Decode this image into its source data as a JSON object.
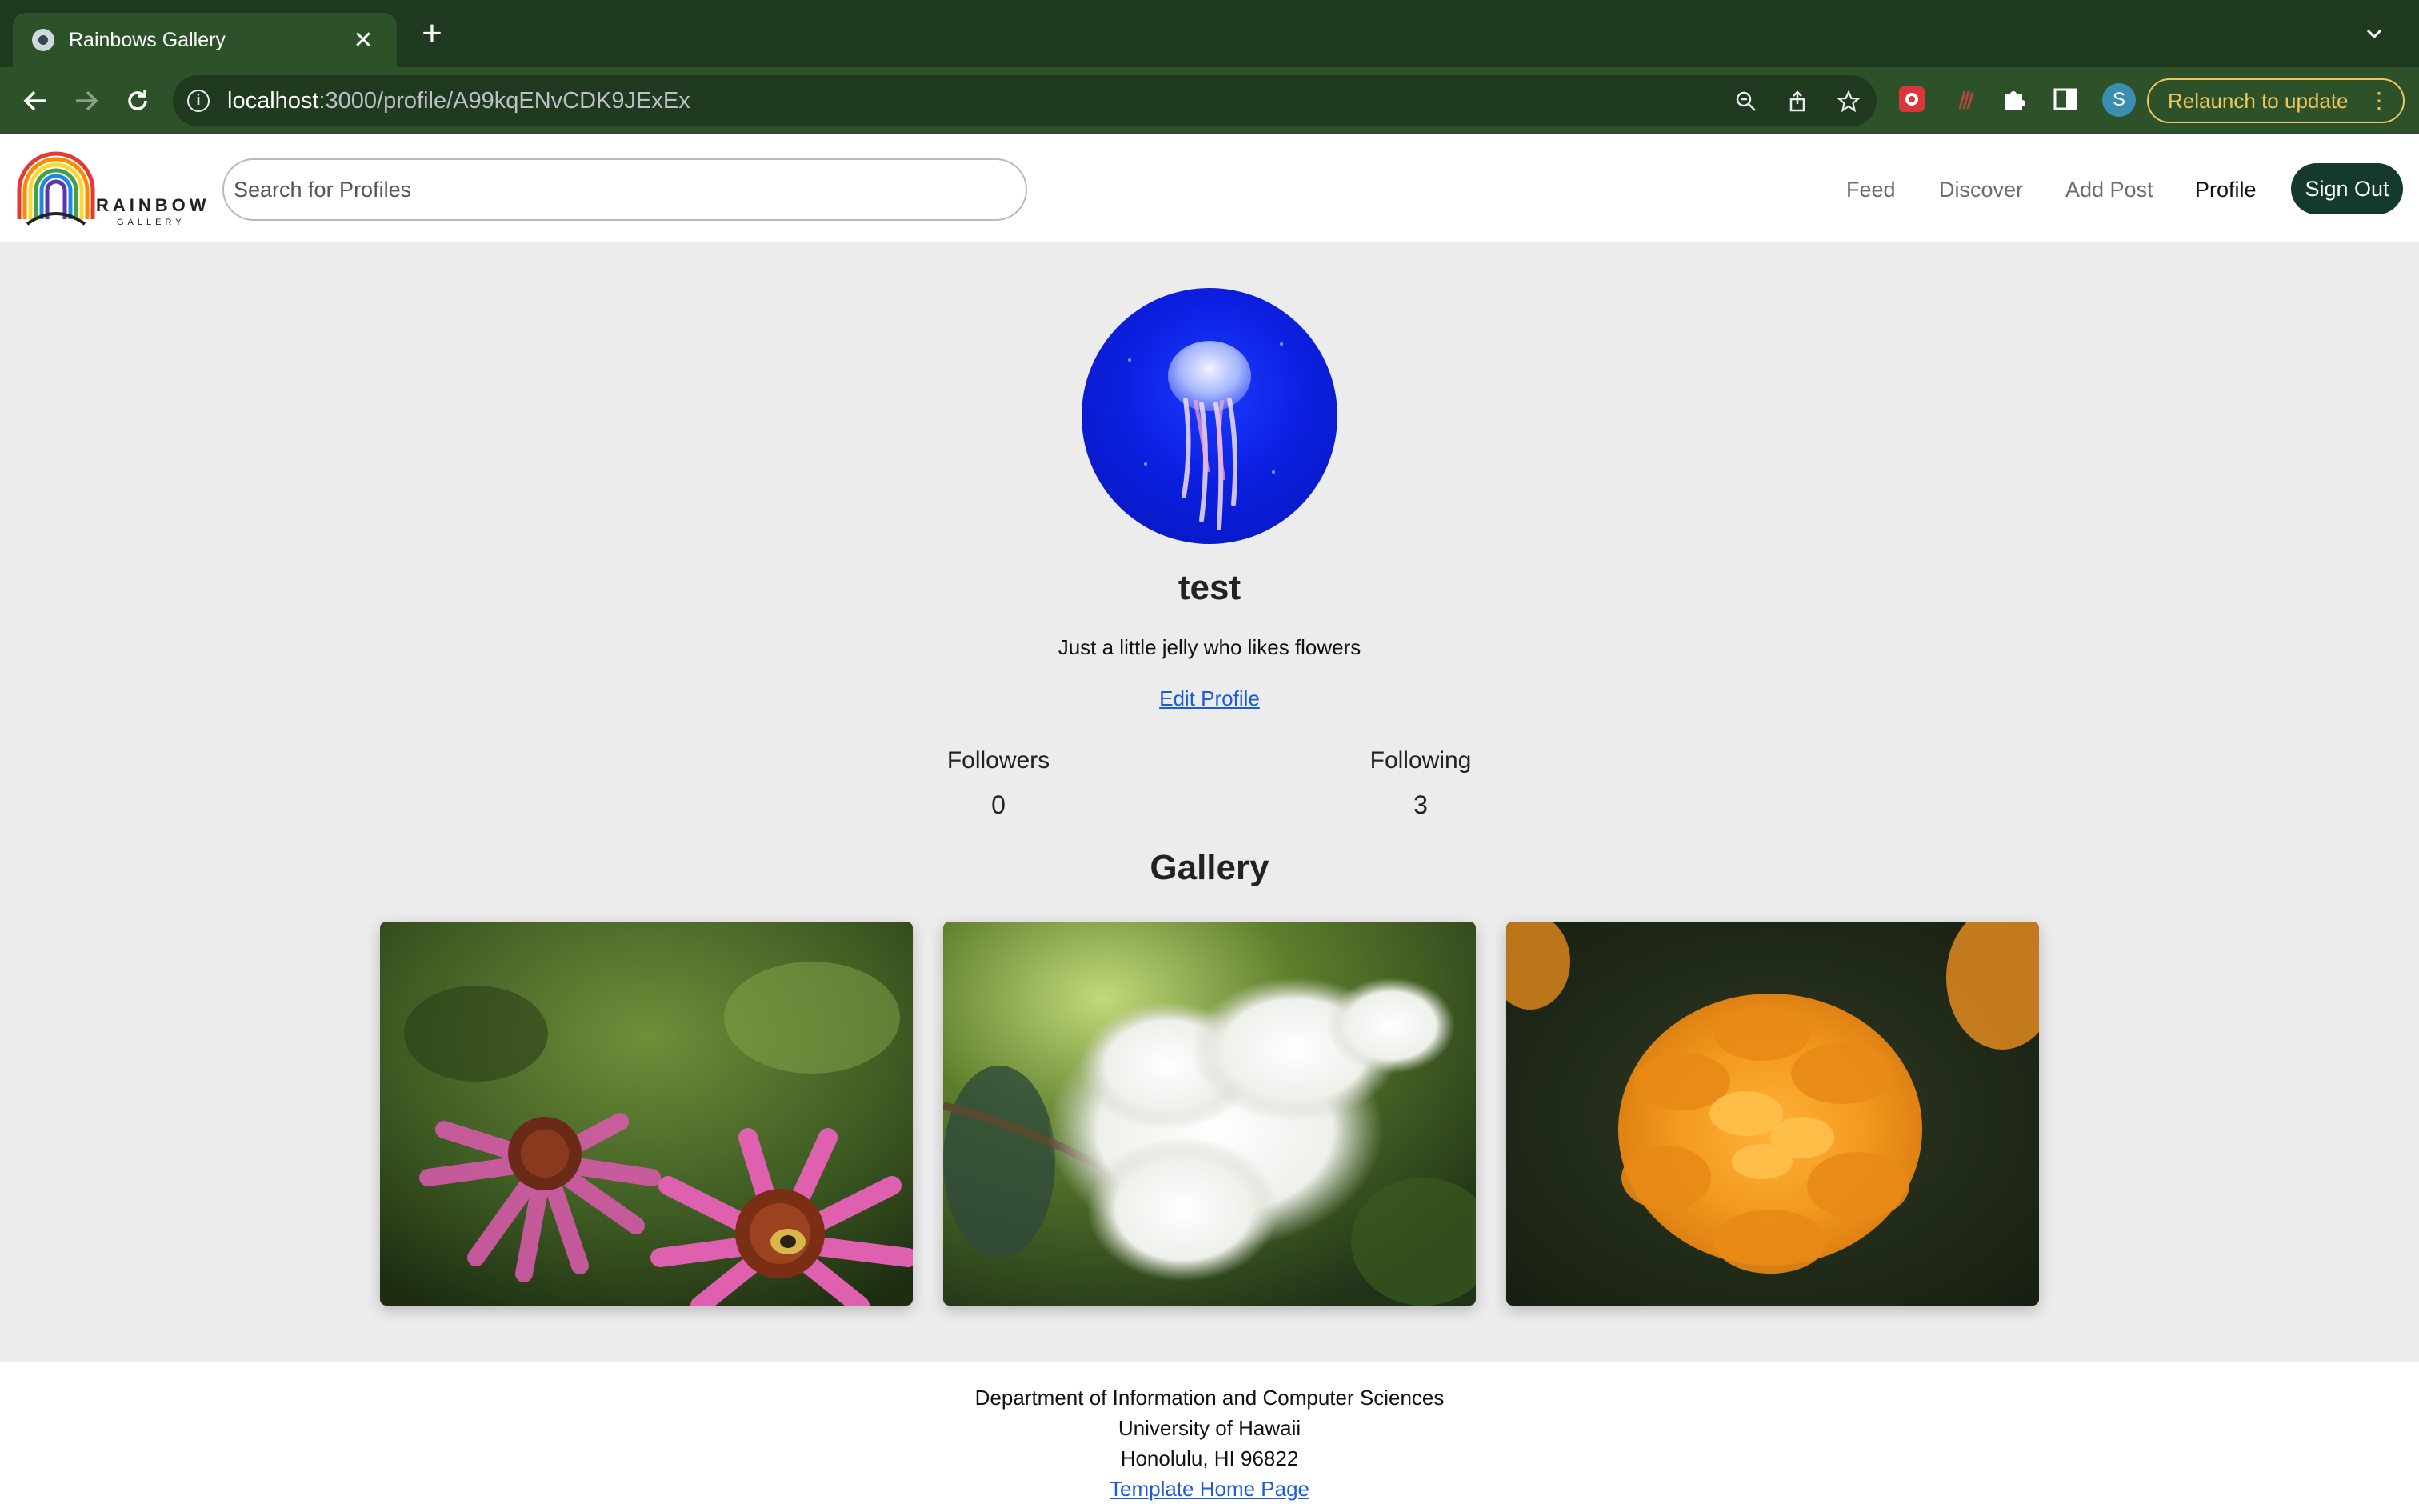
{
  "browser": {
    "tab_title": "Rainbows Gallery",
    "url_host": "localhost",
    "url_path": ":3000/profile/A99kqENvCDK9JExEx",
    "profile_initial": "S",
    "relaunch_label": "Relaunch to update"
  },
  "site": {
    "logo_word": "RAINBOW",
    "logo_sub": "GALLERY",
    "search_placeholder": "Search for Profiles",
    "nav": {
      "feed": "Feed",
      "discover": "Discover",
      "add_post": "Add Post",
      "profile": "Profile",
      "sign_out": "Sign Out"
    }
  },
  "profile": {
    "username": "test",
    "bio": "Just a little jelly who likes flowers",
    "edit_label": "Edit Profile",
    "followers_label": "Followers",
    "followers_count": "0",
    "following_label": "Following",
    "following_count": "3"
  },
  "gallery": {
    "title": "Gallery",
    "images": [
      "pink-coneflowers-with-bee",
      "white-crape-myrtle-blossoms",
      "orange-marigold"
    ]
  },
  "footer": {
    "line1": "Department of Information and Computer Sciences",
    "line2": "University of Hawaii",
    "line3": "Honolulu, HI 96822",
    "link": "Template Home Page"
  },
  "colors": {
    "chrome_dark": "#1f3a1f",
    "chrome_toolbar": "#2d5128",
    "signout_bg": "#143a2c",
    "relaunch": "#f0c75e",
    "link": "#1a5cd9",
    "page_bg": "#ececec"
  }
}
